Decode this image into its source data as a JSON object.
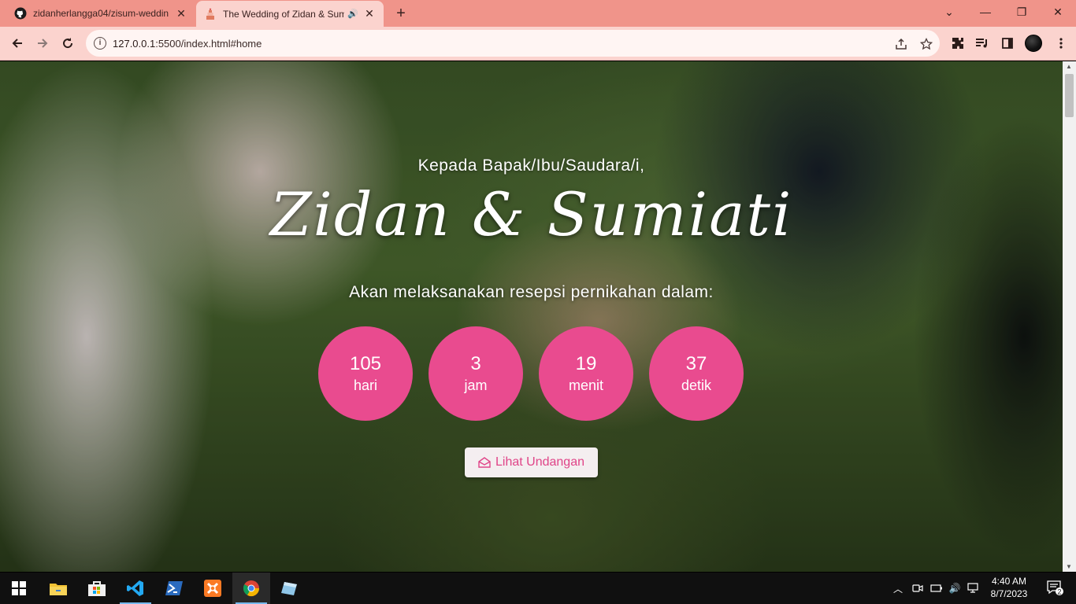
{
  "browser": {
    "tabs": [
      {
        "title": "zidanherlangga04/zisum-weddin",
        "favicon": "github-icon",
        "active": false
      },
      {
        "title": "The Wedding of Zidan & Sum",
        "favicon": "wedding-cake-icon",
        "active": true,
        "audio": true
      }
    ],
    "url": "127.0.0.1:5500/index.html#home",
    "url_host": "127.0.0.1",
    "url_rest": ":5500/index.html#home"
  },
  "page": {
    "greeting": "Kepada Bapak/Ibu/Saudara/i,",
    "couple": "Zidan & Sumiati",
    "subtitle": "Akan melaksanakan resepsi pernikahan dalam:",
    "countdown": [
      {
        "value": "105",
        "unit": "hari"
      },
      {
        "value": "3",
        "unit": "jam"
      },
      {
        "value": "19",
        "unit": "menit"
      },
      {
        "value": "37",
        "unit": "detik"
      }
    ],
    "button_label": "Lihat Undangan",
    "accent": "#e94b8f"
  },
  "taskbar": {
    "time": "4:40 AM",
    "date": "8/7/2023",
    "notification_count": "2"
  }
}
